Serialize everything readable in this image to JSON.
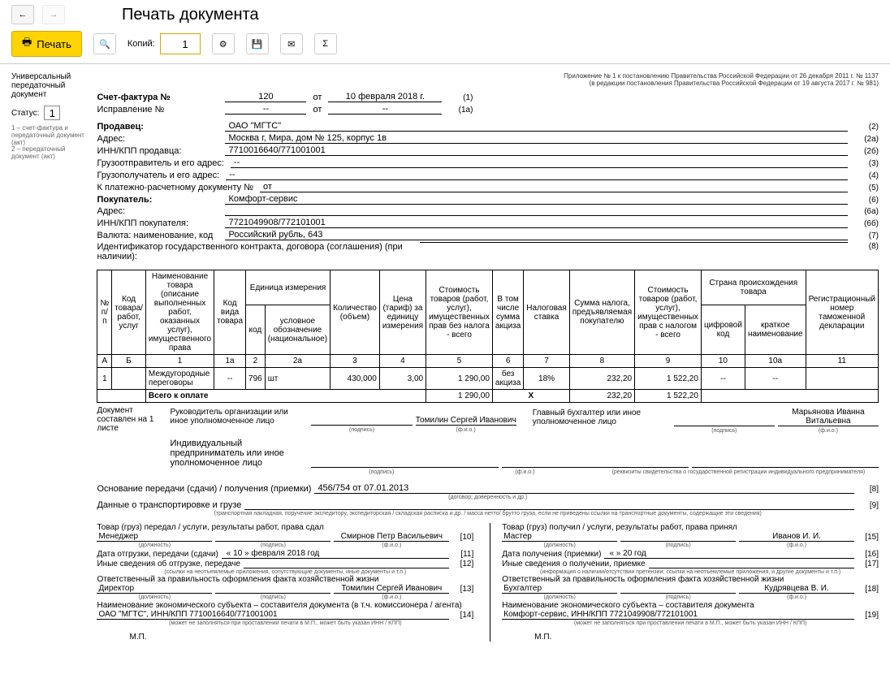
{
  "toolbar": {
    "title": "Печать документа",
    "print": "Печать",
    "copies_label": "Копий:",
    "copies_value": "1"
  },
  "left": {
    "l1": "Универсальный передаточный документ",
    "status_label": "Статус:",
    "status_value": "1",
    "fn": "1 – счет-фактура и передаточный документ (акт)\n2 – передаточный документ (акт)"
  },
  "appendix": "Приложение № 1 к постановлению Правительства Российской Федерации от 26 декабря 2011 г. № 1137\n(в редакции постановления Правительства Российской Федерации от 19 августа 2017 г. № 981)",
  "hdr": {
    "sf_label": "Счет-фактура №",
    "sf_num": "120",
    "ot": "от",
    "sf_date": "10 февраля 2018 г.",
    "n1": "(1)",
    "isp_label": "Исправление №",
    "isp_num": "--",
    "isp_date": "--",
    "n1a": "(1а)"
  },
  "fields": [
    {
      "lbl": "Продавец:",
      "val": "ОАО \"МГТС\"",
      "n": "(2)",
      "bold": true
    },
    {
      "lbl": "Адрес:",
      "val": "Москва г, Мира, дом № 125, корпус 1в",
      "n": "(2а)"
    },
    {
      "lbl": "ИНН/КПП продавца:",
      "val": "7710016640/771001001",
      "n": "(2б)"
    },
    {
      "lbl": "Грузоотправитель и его адрес:",
      "val": "--",
      "n": "(3)"
    },
    {
      "lbl": "Грузополучатель и его адрес:",
      "val": "--",
      "n": "(4)"
    },
    {
      "lbl": "К платежно-расчетному документу №",
      "val": "от",
      "n": "(5)"
    },
    {
      "lbl": "Покупатель:",
      "val": "Комфорт-сервис",
      "n": "(6)",
      "bold": true
    },
    {
      "lbl": "Адрес:",
      "val": "",
      "n": "(6а)"
    },
    {
      "lbl": "ИНН/КПП покупателя:",
      "val": "7721049908/772101001",
      "n": "(6б)"
    },
    {
      "lbl": "Валюта: наименование, код",
      "val": "Российский рубль, 643",
      "n": "(7)"
    }
  ],
  "ident": {
    "lbl": "Идентификатор государственного контракта, договора (соглашения) (при наличии):",
    "val": "",
    "n": "(8)"
  },
  "table": {
    "headers": {
      "c1": "№ п/п",
      "c2": "Код товара/ работ, услуг",
      "c3": "Наименование товара (описание выполненных работ, оказанных услуг), имущественного права",
      "c4": "Код вида товара",
      "c5": "Единица измерения",
      "c5a": "код",
      "c5b": "условное обозначение (национальное)",
      "c6": "Количество (объем)",
      "c7": "Цена (тариф) за единицу измерения",
      "c8": "Стоимость товаров (работ, услуг), имущественных прав без налога - всего",
      "c9": "В том числе сумма акциза",
      "c10": "Налоговая ставка",
      "c11": "Сумма налога, предъявляемая покупателю",
      "c12": "Стоимость товаров (работ, услуг), имущественных прав с налогом - всего",
      "c13": "Страна происхождения товара",
      "c13a": "цифровой код",
      "c13b": "краткое наименование",
      "c14": "Регистрационный номер таможенной декларации"
    },
    "nums": [
      "А",
      "Б",
      "1",
      "1а",
      "2",
      "2а",
      "3",
      "4",
      "5",
      "6",
      "7",
      "8",
      "9",
      "10",
      "10а",
      "11"
    ],
    "row": {
      "n": "1",
      "code": "",
      "name": "Междугородные переговоры",
      "kind": "--",
      "ucode": "796",
      "uname": "шт",
      "qty": "430,000",
      "price": "3,00",
      "sum_no_tax": "1 290,00",
      "excise": "без акциза",
      "rate": "18%",
      "tax": "232,20",
      "sum_tax": "1 522,20",
      "ccode": "--",
      "cname": "--",
      "decl": ""
    },
    "total": {
      "lbl": "Всего к оплате",
      "sum_no_tax": "1 290,00",
      "x": "X",
      "tax": "232,20",
      "sum_tax": "1 522,20"
    }
  },
  "compose": "Документ составлен на 1 листе",
  "signs": {
    "left1": "Руководитель организации или иное уполномоченное лицо",
    "left1_name": "Томилин Сергей Иванович",
    "right1": "Главный бухгалтер или иное уполномоченное лицо",
    "right1_name": "Марьянова Иванна Витальевна",
    "left2": "Индивидуальный предприниматель или иное уполномоченное лицо",
    "podpis": "(подпись)",
    "fio": "(ф.и.о.)",
    "rekv": "(реквизиты свидетельства о государственной регистрации индивидуального предпринимателя)"
  },
  "bottom": {
    "basis_lbl": "Основание передачи (сдачи) / получения (приемки)",
    "basis_val": "456/754 от 07.01.2013",
    "basis_hint": "(договор; доверенность и др.)",
    "n8": "[8]",
    "trans_lbl": "Данные о транспортировке и грузе",
    "trans_hint": "(транспортная накладная, поручение экспедитору, экспедиторская / складская расписка и др. / масса нетто/ брутто груза, если не приведены ссылки на транспортные документы, содержащие эти сведения)",
    "n9": "[9]"
  },
  "left_col": {
    "l1": "Товар (груз) передал / услуги, результаты работ, права сдал",
    "pos": "Менеджер",
    "name": "Смирнов Петр Васильевич",
    "n10": "[10]",
    "date_lbl": "Дата отгрузки, передачи (сдачи)",
    "date_val": "« 10 »   февраля  2018  год",
    "n11": "[11]",
    "other_lbl": "Иные сведения об отгрузке, передаче",
    "n12": "[12]",
    "other_hint": "(ссылки на неотъемлемые приложения, сопутствующие документы, иные документы и т.п.)",
    "resp_lbl": "Ответственный за правильность оформления факта хозяйственной жизни",
    "resp_pos": "Директор",
    "resp_name": "Томилин Сергей Иванович",
    "n13": "[13]",
    "org_lbl": "Наименование экономического субъекта – составителя документа (в т.ч. комиссионера / агента)",
    "org_val": "ОАО \"МГТС\", ИНН/КПП 7710016640/771001001",
    "n14": "[14]",
    "org_hint": "(может не заполняться при проставлении печати в М.П., может быть указан ИНН / КПП)",
    "mp": "М.П.",
    "dolzh": "(должность)"
  },
  "right_col": {
    "l1": "Товар (груз) получил / услуги, результаты работ, права принял",
    "pos": "Мастер",
    "name": "Иванов И. И.",
    "n15": "[15]",
    "date_lbl": "Дата получения (приемки)",
    "date_val": "«          »                    20    год",
    "n16": "[16]",
    "other_lbl": "Иные сведения о получении, приемке",
    "n17": "[17]",
    "other_hint": "(информация о наличии/отсутствии претензии; ссылки на неотъемлемые приложения, и другие документы и т.п.)",
    "resp_lbl": "Ответственный за правильность оформления факта хозяйственной жизни",
    "resp_pos": "Бухгалтер",
    "resp_name": "Кудрявцева В. И.",
    "n18": "[18]",
    "org_lbl": "Наименование экономического субъекта – составителя документа",
    "org_val": "Комфорт-сервис, ИНН/КПП 7721049908/772101001",
    "n19": "[19]",
    "org_hint": "(может не заполняться при проставлении печати в М.П., может быть указан ИНН / КПП)",
    "mp": "М.П."
  }
}
